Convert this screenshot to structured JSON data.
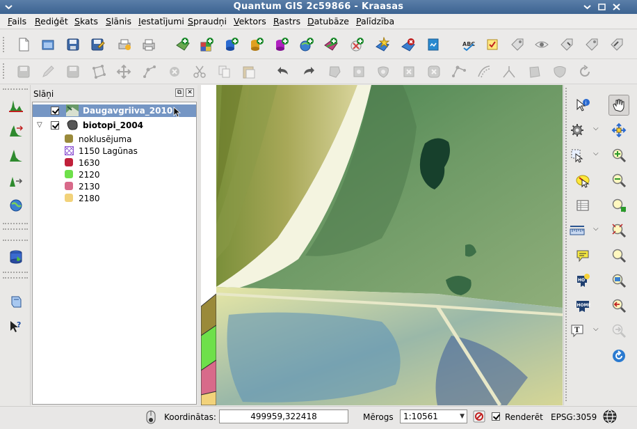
{
  "window": {
    "title": "Quantum GIS 2c59866 - Kraasas"
  },
  "menu": [
    {
      "label": "Fails"
    },
    {
      "label": "Rediģēt"
    },
    {
      "label": "Skats"
    },
    {
      "label": "Slānis"
    },
    {
      "label": "Iestatījumi"
    },
    {
      "label": "Spraudņi"
    },
    {
      "label": "Vektors"
    },
    {
      "label": "Rastrs"
    },
    {
      "label": "Datubāze"
    },
    {
      "label": "Palīdzība"
    }
  ],
  "layers_panel": {
    "title": "Slāņi",
    "items": [
      {
        "label": "Daugavgriiva_2010",
        "checked": true,
        "selected": true
      },
      {
        "label": "biotopi_2004",
        "checked": true,
        "expanded": true
      },
      {
        "label": "noklusējuma",
        "color": "#9a8a3a"
      },
      {
        "label": "1150 Lagūnas",
        "color": "#8a4fd0"
      },
      {
        "label": "1630",
        "color": "#c0203a"
      },
      {
        "label": "2120",
        "color": "#6ee04a"
      },
      {
        "label": "2130",
        "color": "#d86a8a"
      },
      {
        "label": "2180",
        "color": "#f2d27a"
      }
    ]
  },
  "statusbar": {
    "coord_label": "Koordinātas:",
    "coord_value": "499959,322418",
    "scale_label": "Mērogs",
    "scale_value": "1:10561",
    "render_label": "Renderēt",
    "render_checked": true,
    "crs": "EPSG:3059"
  },
  "colors": {
    "titlebar": "#4a709e",
    "selection": "#7596c4"
  }
}
